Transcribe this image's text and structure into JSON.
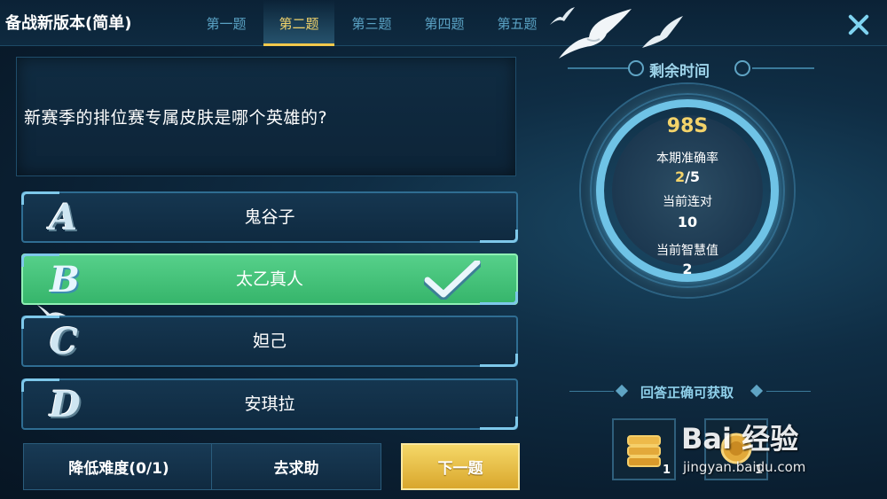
{
  "app": {
    "title": "备战新版本(简单)"
  },
  "tabs": [
    {
      "label": "第一题"
    },
    {
      "label": "第二题"
    },
    {
      "label": "第三题"
    },
    {
      "label": "第四题"
    },
    {
      "label": "第五题"
    }
  ],
  "active_tab": 1,
  "question": {
    "text": "新赛季的排位赛专属皮肤是哪个英雄的?"
  },
  "options": [
    {
      "letter": "A",
      "text": "鬼谷子",
      "state": "normal"
    },
    {
      "letter": "B",
      "text": "太乙真人",
      "state": "correct"
    },
    {
      "letter": "C",
      "text": "妲己",
      "state": "normal"
    },
    {
      "letter": "D",
      "text": "安琪拉",
      "state": "normal"
    }
  ],
  "buttons": {
    "lower_difficulty": "降低难度(0/1)",
    "ask_help": "去求助",
    "next": "下一题"
  },
  "timer": {
    "label": "剩余时间",
    "value": "98S",
    "accuracy_label": "本期准确率",
    "accuracy_correct": "2",
    "accuracy_total": "/5",
    "streak_label": "当前连对",
    "streak_value": "10",
    "wisdom_label": "当前智慧值",
    "wisdom_value": "2"
  },
  "reward": {
    "label": "回答正确可获取",
    "items": [
      {
        "icon": "coin-stack-icon",
        "count": "1"
      },
      {
        "icon": "gold-coin-icon",
        "count": "1"
      }
    ]
  },
  "watermark": {
    "brand": "Bai 经验",
    "url": "jingyan.baidu.com"
  },
  "colors": {
    "accent_gold": "#f2c94c",
    "correct_green": "#3fbf74",
    "ring_blue": "#6fc3e6"
  }
}
